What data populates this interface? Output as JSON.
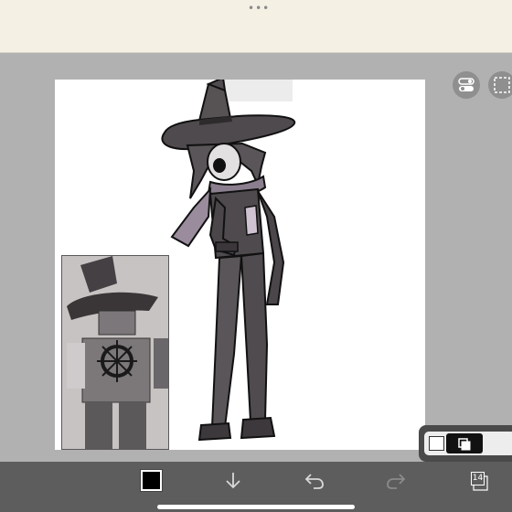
{
  "top_bar": {
    "dots": "•••"
  },
  "toolbar": {
    "color": "#000000",
    "layer_count": "14"
  },
  "colors": {
    "accent_dark": "#000000",
    "canvas": "#ffffff",
    "workspace": "#b1b1b1",
    "top_bar": "#f4f1e4",
    "bottom_bar": "#5d5d5d"
  },
  "icons": {
    "toolbar": [
      "color-swatch",
      "download-icon",
      "undo-icon",
      "redo-icon",
      "layers-icon"
    ],
    "side": [
      "toggle-icon",
      "selection-icon"
    ],
    "layer_panel": [
      "white-layer-icon",
      "copy-layer-icon"
    ]
  }
}
